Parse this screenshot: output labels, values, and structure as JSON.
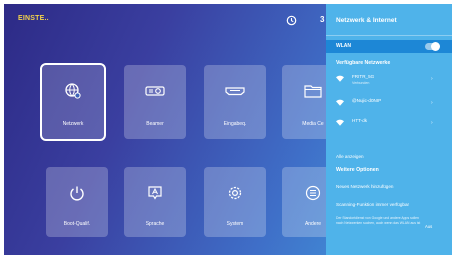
{
  "topbar": {
    "app_title": "EINSTE..",
    "extra": "3"
  },
  "tiles_row1": [
    {
      "label": "Netzwerk",
      "icon": "globe-gear-icon",
      "selected": true
    },
    {
      "label": "Beamer",
      "icon": "projector-icon"
    },
    {
      "label": "Eingabeq.",
      "icon": "hdmi-icon"
    },
    {
      "label": "Media Ce",
      "icon": "folder-icon"
    }
  ],
  "tiles_row2": [
    {
      "label": "Boot-Qualif.",
      "icon": "power-icon"
    },
    {
      "label": "Sprache",
      "icon": "language-icon"
    },
    {
      "label": "System",
      "icon": "gear-icon"
    },
    {
      "label": "Andere",
      "icon": "menu-icon"
    }
  ],
  "panel": {
    "title": "Netzwerk & Internet",
    "wlan_label": "WLAN",
    "wlan_on": true,
    "available_heading": "Verfügbare Netzwerke",
    "networks": [
      {
        "name": "FRITR_5G",
        "sub": "Verbunden"
      },
      {
        "name": "@Nujic-d0NIP",
        "sub": ""
      },
      {
        "name": "HTT-dk",
        "sub": ""
      }
    ],
    "show_all": "Alle anzeigen",
    "more_options": "Weitere Optionen",
    "add_network": "Neues Netzwerk hinzufügen",
    "scan_setting": "Scanning-Funktion immer verfügbar",
    "scan_desc": "Der Standortdienst von Google und andere Apps sollen nach Netzwerken suchen, auch wenn das WLAN aus ist",
    "scan_toggle_label": "Aus"
  },
  "colors": {
    "panel_bg": "#4fb3ea",
    "wlan_row_bg": "#1d87d6",
    "title_accent": "#f3d24a"
  }
}
